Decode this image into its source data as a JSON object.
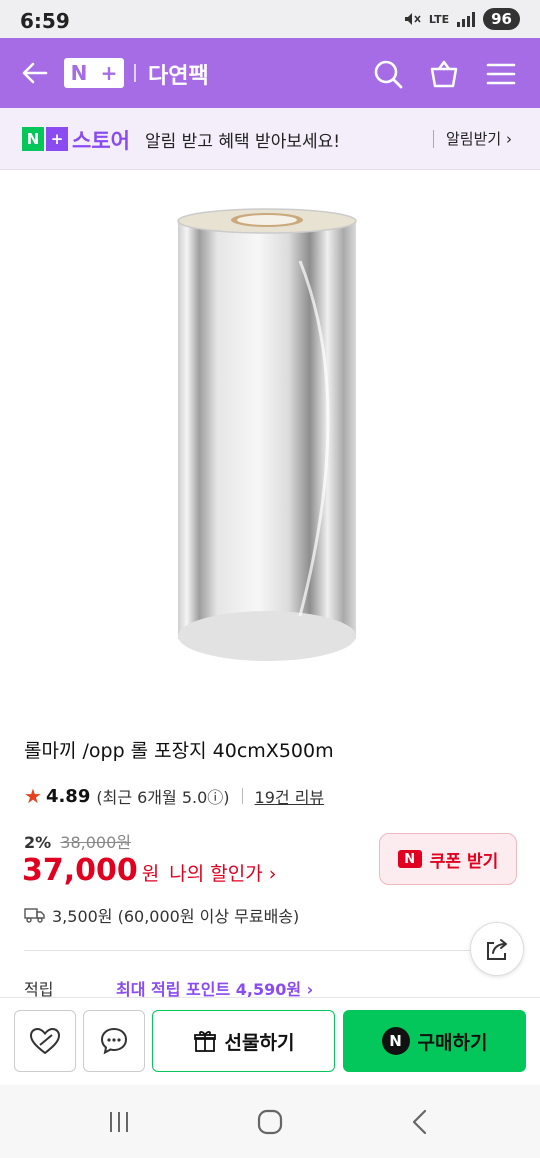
{
  "status_bar": {
    "time": "6:59",
    "network": "LTE",
    "battery": "96"
  },
  "header": {
    "logo_n": "N",
    "logo_plus": "+",
    "store_name": "다연팩"
  },
  "notify_banner": {
    "logo_n": "N",
    "logo_plus": "+",
    "store_word": "스토어",
    "message": "알림 받고 혜택 받아보세요!",
    "action": "알림받기 ›"
  },
  "product": {
    "title": "롤마끼 /opp 롤 포장지 40cmX500m",
    "rating": "4.89",
    "rating_recent": "(최근 6개월 5.0ⓘ)",
    "review_count": "19건 리뷰",
    "discount_rate": "2%",
    "original_price": "38,000원",
    "price": "37,000",
    "price_unit": "원",
    "my_discount": "나의 할인가 ›",
    "coupon_label": "쿠폰 받기",
    "coupon_n": "N",
    "shipping": "3,500원 (60,000원 이상 무료배송)",
    "points_label": "적립",
    "points_value": "최대 적립 포인트 4,590원 ›"
  },
  "actions": {
    "gift": "선물하기",
    "buy": "구매하기",
    "buy_n": "N"
  },
  "colors": {
    "brand_purple": "#a56ce6",
    "naver_green": "#03c75a",
    "price_red": "#e1001f"
  }
}
